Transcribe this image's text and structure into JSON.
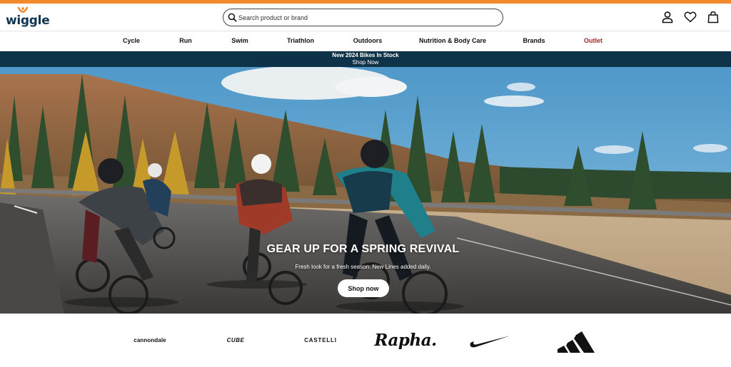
{
  "header": {
    "logo_text": "wiggle",
    "search_placeholder": "Search product or brand"
  },
  "icons": {
    "search": "search-icon",
    "account": "user-icon",
    "wishlist": "heart-icon",
    "basket": "shopping-bag-icon"
  },
  "nav": {
    "items": [
      {
        "label": "Cycle"
      },
      {
        "label": "Run"
      },
      {
        "label": "Swim"
      },
      {
        "label": "Triathlon"
      },
      {
        "label": "Outdoors"
      },
      {
        "label": "Nutrition & Body Care"
      },
      {
        "label": "Brands"
      },
      {
        "label": "Outlet"
      }
    ]
  },
  "promo": {
    "title": "New 2024 Bikes In Stock",
    "link": "Shop Now"
  },
  "hero": {
    "title": "GEAR UP FOR A SPRING REVIVAL",
    "subtitle": "Fresh look for a fresh season. New Lines added daily.",
    "button_label": "Shop now"
  },
  "brands": {
    "items": [
      {
        "label": "cannondale"
      },
      {
        "label": "CUBE"
      },
      {
        "label": "CASTELLI"
      },
      {
        "label": "Rapha."
      },
      {
        "label": "Nike",
        "logo": "nike-swoosh-icon"
      },
      {
        "label": "adidas",
        "logo": "adidas-stripes-icon"
      }
    ]
  },
  "colors": {
    "accent_stripe": "#f08a2c",
    "promo_bar": "#0e3247",
    "outlet_link": "#a3282a",
    "logo": "#0f3550"
  }
}
